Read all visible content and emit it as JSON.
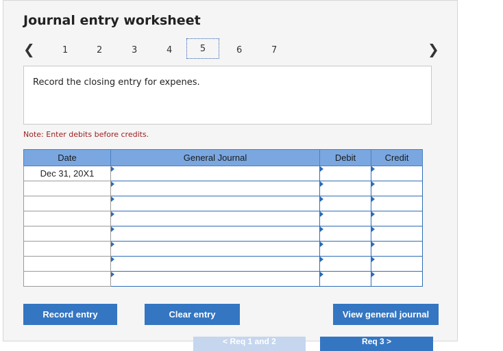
{
  "title": "Journal entry worksheet",
  "nav": {
    "prev_icon": "chevron-left-icon",
    "next_icon": "chevron-right-icon",
    "steps": [
      "1",
      "2",
      "3",
      "4",
      "5",
      "6",
      "7"
    ],
    "active_step": "5"
  },
  "prompt": "Record the closing entry for expenes.",
  "note": "Note: Enter debits before credits.",
  "table": {
    "headers": [
      "Date",
      "General Journal",
      "Debit",
      "Credit"
    ],
    "rows": [
      {
        "date": "Dec 31, 20X1",
        "account": "",
        "debit": "",
        "credit": ""
      },
      {
        "date": "",
        "account": "",
        "debit": "",
        "credit": ""
      },
      {
        "date": "",
        "account": "",
        "debit": "",
        "credit": ""
      },
      {
        "date": "",
        "account": "",
        "debit": "",
        "credit": ""
      },
      {
        "date": "",
        "account": "",
        "debit": "",
        "credit": ""
      },
      {
        "date": "",
        "account": "",
        "debit": "",
        "credit": ""
      },
      {
        "date": "",
        "account": "",
        "debit": "",
        "credit": ""
      },
      {
        "date": "",
        "account": "",
        "debit": "",
        "credit": ""
      }
    ]
  },
  "buttons": {
    "record": "Record entry",
    "clear": "Clear entry",
    "view": "View general journal"
  },
  "bottom_nav": {
    "prev": "< Req 1 and 2",
    "next": "Req 3 >"
  },
  "colors": {
    "button": "#3476c2",
    "header": "#7aa7e0",
    "note": "#9b1c1c",
    "req_prev": "#c5d6ee",
    "req_next": "#3476c2"
  }
}
